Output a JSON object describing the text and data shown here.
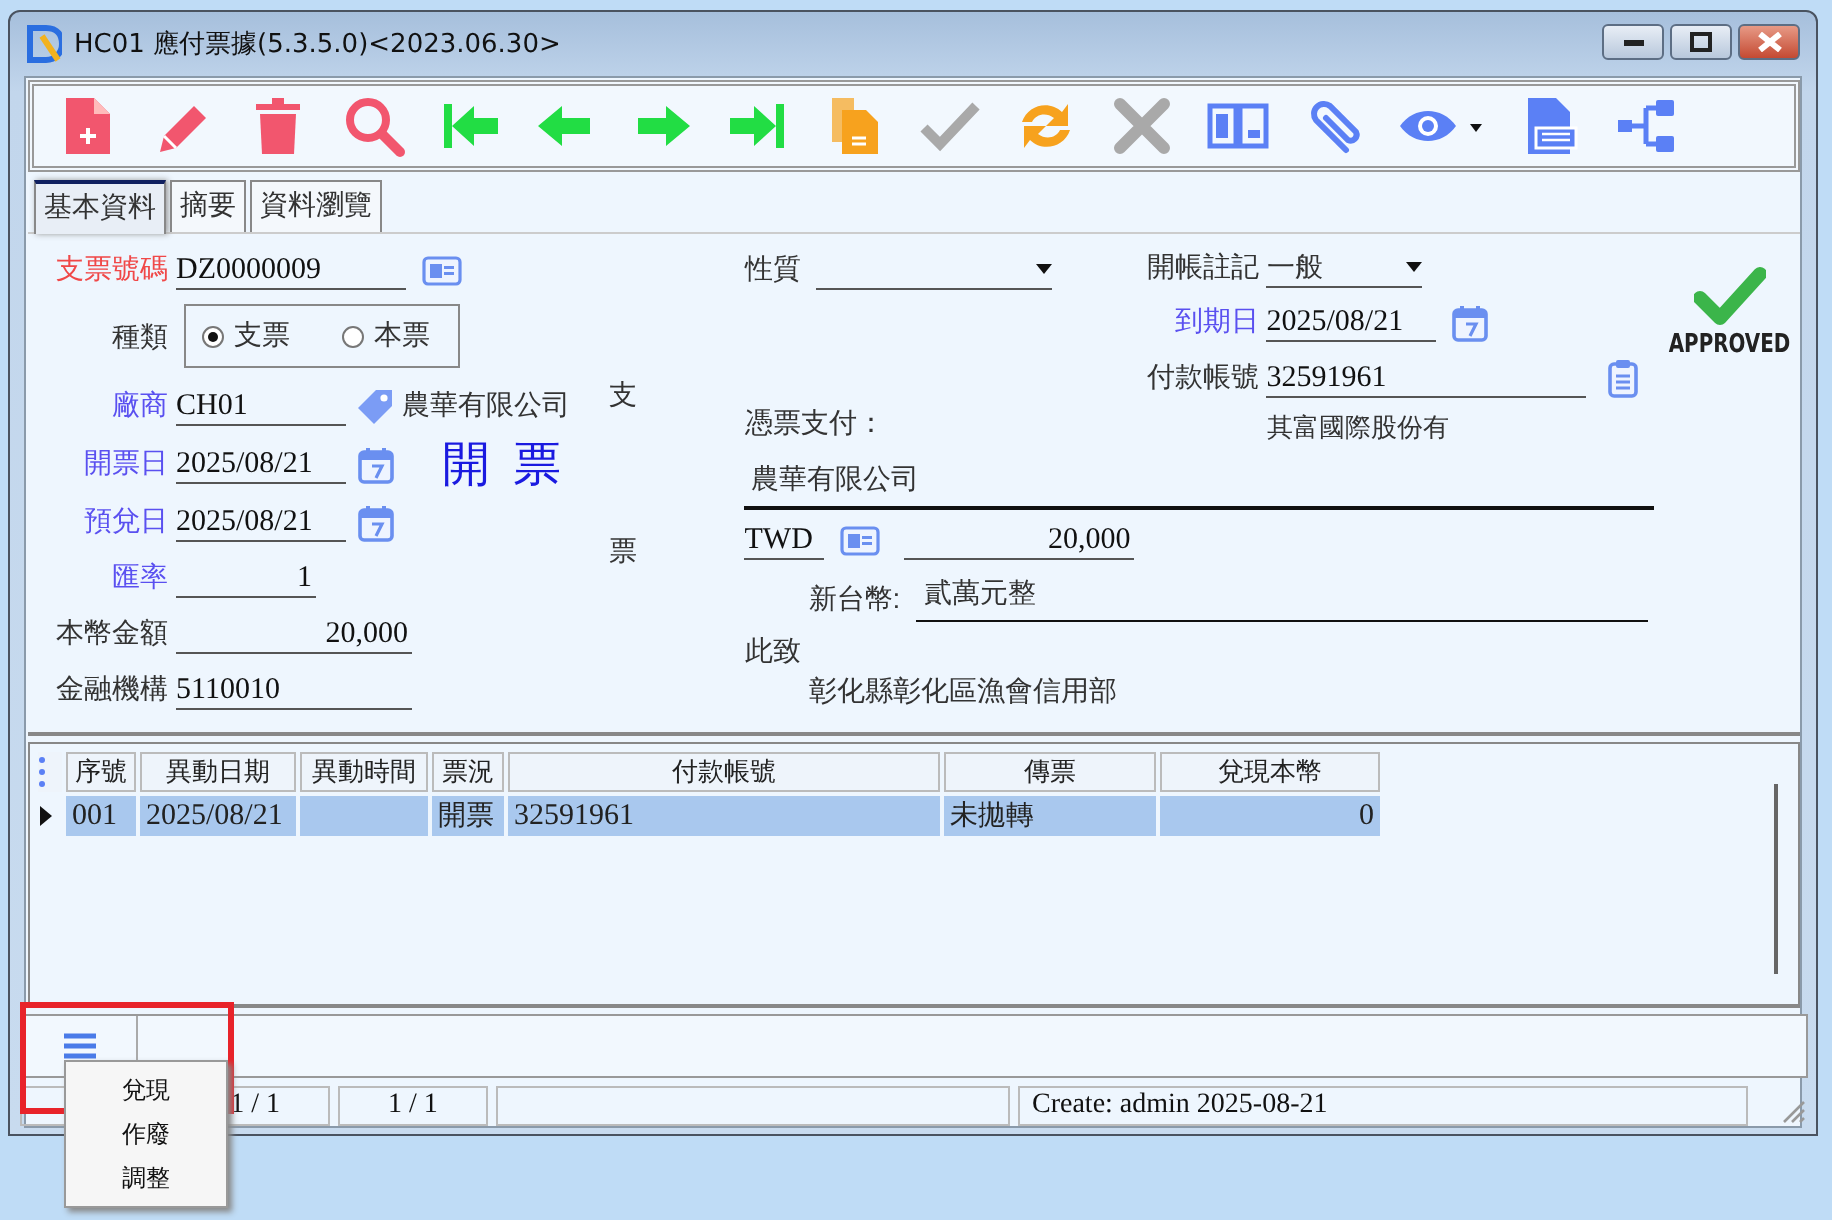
{
  "window": {
    "title": "HC01 應付票據(5.3.5.0)<2023.06.30>"
  },
  "toolbar": [
    {
      "kind": "new",
      "disabled": false
    },
    {
      "kind": "edit",
      "disabled": false
    },
    {
      "kind": "delete",
      "disabled": false
    },
    {
      "kind": "search",
      "disabled": false
    },
    {
      "kind": "first",
      "disabled": false
    },
    {
      "kind": "prev",
      "disabled": false
    },
    {
      "kind": "next",
      "disabled": false
    },
    {
      "kind": "last",
      "disabled": false
    },
    {
      "kind": "copy",
      "disabled": false
    },
    {
      "kind": "confirm",
      "disabled": true
    },
    {
      "kind": "refresh",
      "disabled": false
    },
    {
      "kind": "cancel",
      "disabled": true
    },
    {
      "kind": "book",
      "disabled": false
    },
    {
      "kind": "attach",
      "disabled": false
    },
    {
      "kind": "view",
      "disabled": false
    },
    {
      "kind": "excel",
      "disabled": false
    },
    {
      "kind": "tree",
      "disabled": false
    }
  ],
  "tabs": [
    {
      "label": "基本資料",
      "selected": true
    },
    {
      "label": "摘要",
      "selected": false
    },
    {
      "label": "資料瀏覽",
      "selected": false
    }
  ],
  "left_fields": [
    {
      "kind": "lookup",
      "label": "支票號碼",
      "color": "#f04848",
      "value": "DZ0000009"
    },
    {
      "kind": "radio",
      "label": "種類",
      "color": "#333333",
      "options": [
        {
          "label": "支票",
          "selected": true
        },
        {
          "label": "本票",
          "selected": false
        }
      ]
    },
    {
      "kind": "vendor",
      "label": "廠商",
      "color": "#5a50f0",
      "value": "CH01",
      "name": "農華有限公司"
    },
    {
      "kind": "date",
      "label": "開票日",
      "color": "#5a50f0",
      "value": "2025/08/21"
    },
    {
      "kind": "date",
      "label": "預兌日",
      "color": "#5a50f0",
      "value": "2025/08/21"
    },
    {
      "kind": "number",
      "label": "匯率",
      "color": "#5a50f0",
      "value": "1"
    },
    {
      "kind": "number",
      "label": "本幣金額",
      "color": "#333333",
      "value": "20,000"
    },
    {
      "kind": "text",
      "label": "金融機構",
      "color": "#333333",
      "value": "5110010"
    }
  ],
  "status_stamp": "開 票",
  "side_label": [
    "支",
    "票"
  ],
  "nature": {
    "label": "性質"
  },
  "right_fields": [
    {
      "kind": "dropdown",
      "label": "開帳註記",
      "color": "#333333",
      "value": "一般"
    },
    {
      "kind": "date",
      "label": "到期日",
      "color": "#5a50f0",
      "value": "2025/08/21"
    },
    {
      "kind": "account",
      "label": "付款帳號",
      "color": "#333333",
      "value": "32591961",
      "note": "其富國際股份有"
    }
  ],
  "approval": {
    "approved": true,
    "label": "APPROVED"
  },
  "cheque": {
    "pay_label": "憑票支付：",
    "payee": "農華有限公司",
    "currency": "TWD",
    "amount": "20,000",
    "words_label": "新台幣:",
    "amount_words": "貳萬元整",
    "closing": "此致",
    "bank": "彰化縣彰化區漁會信用部"
  },
  "grid": {
    "columns": [
      "序號",
      "異動日期",
      "異動時間",
      "票況",
      "付款帳號",
      "傳票",
      "兌現本幣"
    ],
    "rows": [
      {
        "selected": true,
        "cells": [
          "001",
          "2025/08/21",
          null,
          "開票",
          "32591961",
          "未拋轉",
          "0"
        ]
      }
    ]
  },
  "bottom_bar": {
    "highlighted": true
  },
  "status_bar": [
    "1 / 1",
    "1 / 1",
    "Create: admin 2025-08-21"
  ],
  "popup_menu": [
    {
      "label": "兌現"
    },
    {
      "label": "作廢"
    },
    {
      "label": "調整"
    }
  ]
}
